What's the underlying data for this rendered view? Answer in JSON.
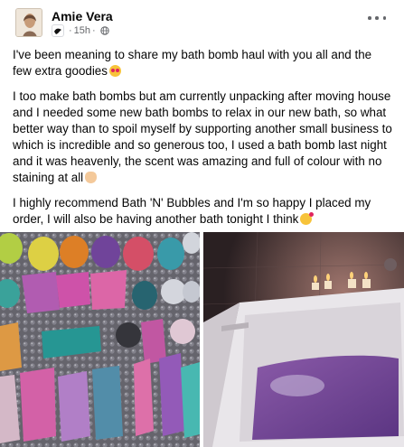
{
  "post": {
    "author": "Amie Vera",
    "time": "15h",
    "separator": "·",
    "paragraphs": [
      "I've been meaning to share my bath bomb haul with you all and the few extra goodies",
      "I too make bath bombs but am currently unpacking after moving house and I needed some new bath bombs to relax in our new bath, so what better way than to spoil myself by supporting another small business to which is incredible and so generous too, I used a bath bomb last night and it was heavenly, the scent was amazing and full of colour with no staining at all",
      "I highly recommend Bath 'N' Bubbles and I'm so happy I placed my order, I will also be having another bath tonight I think"
    ],
    "emojis": [
      "heart-eyes-emoji",
      "palms-up-emoji",
      "smiling-face-with-hearts-emoji"
    ]
  },
  "photos": {
    "left": "bath bombs photo",
    "right": "bathtub photo"
  },
  "colors": {
    "text": "#050505",
    "meta": "#65676b",
    "background": "#ffffff"
  }
}
